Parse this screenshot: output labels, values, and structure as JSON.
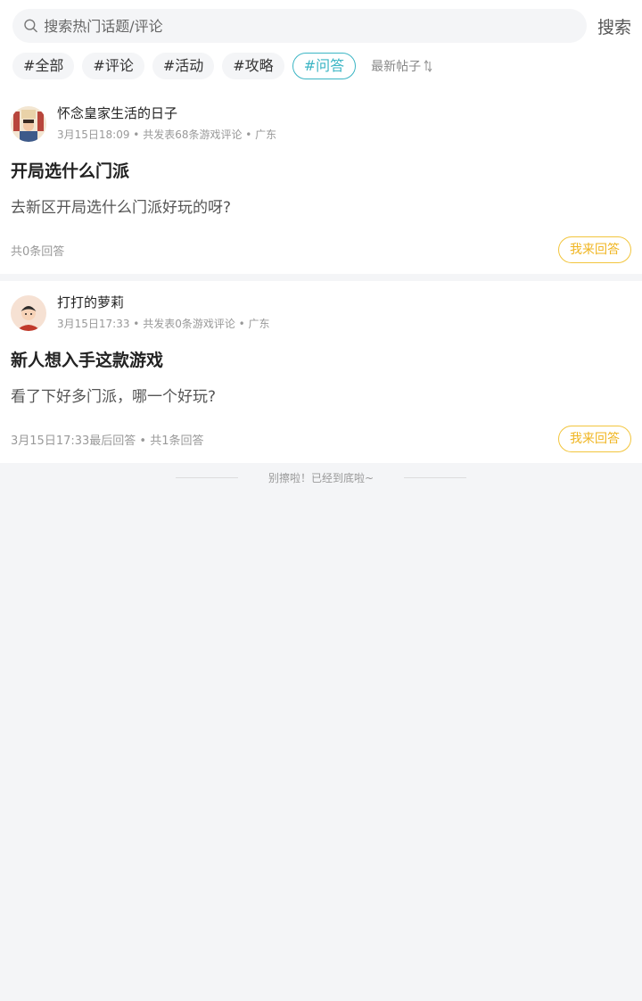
{
  "search": {
    "placeholder": "搜索热门话题/评论",
    "button_label": "搜索"
  },
  "tags": [
    {
      "label": "#全部",
      "active": false
    },
    {
      "label": "#评论",
      "active": false
    },
    {
      "label": "#活动",
      "active": false
    },
    {
      "label": "#攻略",
      "active": false
    },
    {
      "label": "#问答",
      "active": true
    }
  ],
  "sort_label": "最新帖子",
  "posts": [
    {
      "username": "怀念皇家生活的日子",
      "meta": "3月15日18:09 • 共发表68条游戏评论 • 广东",
      "title": "开局选什么门派",
      "body": "去新区开局选什么门派好玩的呀?",
      "footer": "共0条回答",
      "answer_label": "我来回答",
      "avatar_icon": "avatar-royal-icon"
    },
    {
      "username": "打打的萝莉",
      "meta": "3月15日17:33 • 共发表0条游戏评论 • 广东",
      "title": "新人想入手这款游戏",
      "body": "看了下好多门派，哪一个好玩?",
      "footer": "3月15日17:33最后回答 • 共1条回答",
      "answer_label": "我来回答",
      "avatar_icon": "avatar-boy-icon"
    }
  ],
  "bottom_tip": "别擦啦！已经到底啦~",
  "colors": {
    "accent": "#3bb5c4",
    "answer": "#f0b520",
    "background": "#f4f5f7"
  }
}
